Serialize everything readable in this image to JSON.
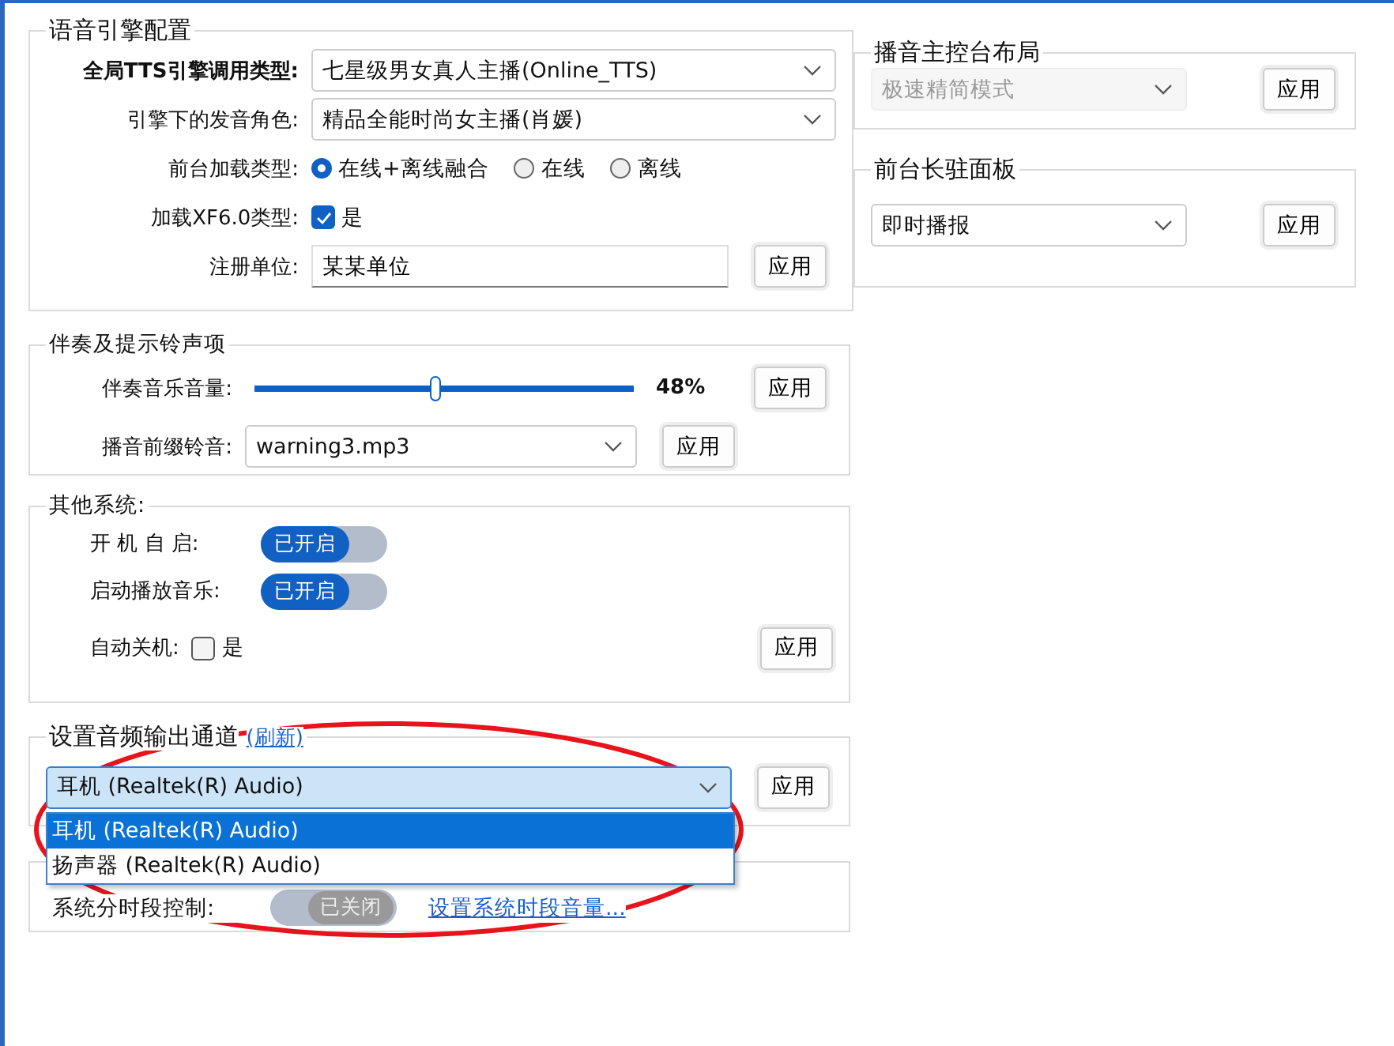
{
  "engine_config": {
    "title": "语音引擎配置",
    "rows": [
      {
        "kind": "select",
        "label": "全局TTS引擎调用类型:",
        "value": "七星级男女真人主播(Online_TTS)"
      },
      {
        "kind": "select",
        "label": "引擎下的发音角色:",
        "value": "精品全能时尚女主播(肖媛)"
      },
      {
        "kind": "radio",
        "label": "前台加载类型:",
        "options": [
          {
            "label": "在线+离线融合",
            "selected": true
          },
          {
            "label": "在线",
            "selected": false
          },
          {
            "label": "离线",
            "selected": false
          }
        ]
      },
      {
        "kind": "checkbox",
        "label": "加载XF6.0类型:",
        "option": "是",
        "checked": true
      },
      {
        "kind": "text",
        "label": "注册单位:",
        "value": "某某单位",
        "button": "应用"
      }
    ]
  },
  "accompaniment": {
    "title": "伴奏及提示铃声项",
    "volume": {
      "label": "伴奏音乐音量:",
      "level": 0.48,
      "reading": "48%",
      "button": "应用"
    },
    "prefix_sound": {
      "label": "播音前缀铃音:",
      "value": "warning3.mp3",
      "button": "应用"
    }
  },
  "other_system": {
    "title": "其他系统:",
    "rows": [
      {
        "kind": "toggle",
        "label": "开 机 自 启:",
        "on": true,
        "state_text": "已开启"
      },
      {
        "kind": "toggle",
        "label": "启动播放音乐:",
        "on": true,
        "state_text": "已开启"
      },
      {
        "kind": "checkbox",
        "label": "自动关机:",
        "option": "是",
        "checked": false
      }
    ],
    "button": "应用"
  },
  "audio_output": {
    "title": "设置音频输出通道",
    "refresh_link": "(刷新)",
    "value": "耳机 (Realtek(R) Audio)",
    "button": "应用",
    "dropdown": {
      "options": [
        {
          "label": "耳机 (Realtek(R) Audio)",
          "selected": true
        },
        {
          "label": "扬声器 (Realtek(R) Audio)",
          "selected": false
        }
      ]
    }
  },
  "time_control": {
    "label": "系统分时段控制:",
    "toggle": {
      "on": false,
      "state_text": "已关闭"
    },
    "link": "设置系统时段音量..."
  },
  "console_layout": {
    "title": "播音主控台布局",
    "value": "极速精简模式",
    "disabled": true,
    "button": "应用"
  },
  "resident_panel": {
    "title": "前台长驻面板",
    "value": "即时播报",
    "button": "应用"
  }
}
